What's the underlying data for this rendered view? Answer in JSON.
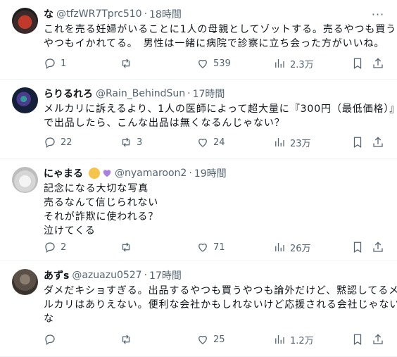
{
  "tweets": [
    {
      "name": "な",
      "handle": "@tfzWR7Tprc510",
      "time": "18時間",
      "lines": [
        "これを売る妊婦がいることに1人の母親としてゾットする。売るやつも買う",
        "やつもイかれてる。　男性は一緒に病院で診察に立ち会った方がいいね。"
      ],
      "replies": "1",
      "retweets": "",
      "likes": "539",
      "views": "2.3万",
      "avatar_color": "#8a1a1a"
    },
    {
      "name": "らりるれろ",
      "handle": "@Rain_BehindSun",
      "time": "17時間",
      "lines": [
        "メルカリに訴えるより、1人の医師によって超大量に『300円（最低価格）』",
        "で出品したら、こんな出品は無くなるんじゃない？"
      ],
      "replies": "22",
      "retweets": "3",
      "likes": "24",
      "views": "23万",
      "avatar_color": "#1a2a40"
    },
    {
      "name": "にゃまる",
      "handle": "@nyamaroon2",
      "time": "19時間",
      "lines": [
        "記念になる大切な写真",
        "売るなんて信じられない",
        "それが詐欺に使われる？",
        "泣けてくる"
      ],
      "replies": "2",
      "retweets": "",
      "likes": "71",
      "views": "26万",
      "avatar_color": "#cfcfcf"
    },
    {
      "name": "あずs",
      "handle": "@azuazu0527",
      "time": "17時間",
      "lines": [
        "ダメだキショすぎる。出品するやつも買うやつも論外だけど、黙認してるメ",
        "ルカリはありえない。便利な会社かもしれないけど応援される会社じゃない",
        "な"
      ],
      "replies": "",
      "retweets": "",
      "likes": "25",
      "views": "1.2万",
      "avatar_color": "#5a5048"
    }
  ],
  "separator": "·",
  "more_icon": "more-horizontal-icon"
}
